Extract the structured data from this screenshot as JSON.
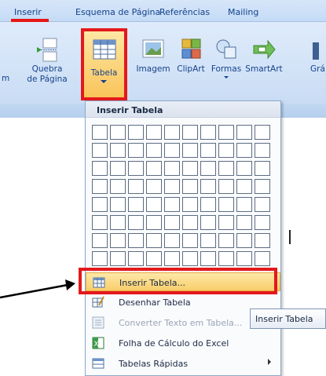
{
  "tabs": [
    "Inserir",
    "Esquema de Página",
    "Referências",
    "Mailing"
  ],
  "ribbon": {
    "quebra_label_1": "Quebra",
    "quebra_label_2": "de Página",
    "partial_left": "m",
    "tabela": "Tabela",
    "imagem": "Imagem",
    "clipart": "ClipArt",
    "formas": "Formas",
    "smartart": "SmartArt",
    "grafico_partial": "Grá"
  },
  "dropdown": {
    "header": "Inserir Tabela",
    "grid_cols": 10,
    "grid_rows": 8,
    "items": [
      {
        "label": "Inserir Tabela...",
        "icon": "insert-table-icon",
        "state": "active"
      },
      {
        "label": "Desenhar Tabela",
        "icon": "draw-table-icon",
        "state": "normal"
      },
      {
        "label": "Converter Texto em Tabela...",
        "icon": "convert-text-icon",
        "state": "disabled"
      },
      {
        "label": "Folha de Cálculo do Excel",
        "icon": "excel-sheet-icon",
        "state": "normal"
      },
      {
        "label": "Tabelas Rápidas",
        "icon": "quick-tables-icon",
        "state": "normal"
      }
    ]
  },
  "tooltip": "Inserir Tabela",
  "colors": {
    "highlight_red": "#e3191b",
    "ribbon_blue": "#15428b",
    "hover_orange": "#f8cd6a"
  }
}
